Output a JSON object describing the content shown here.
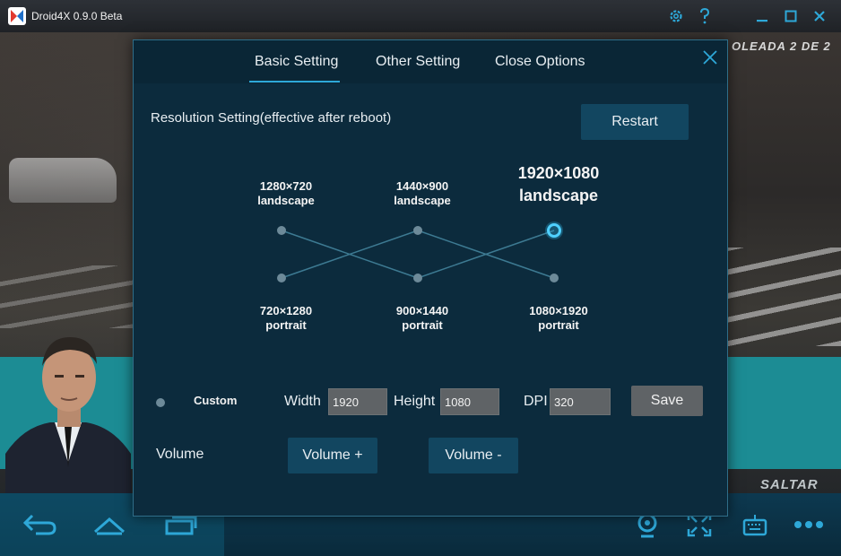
{
  "window": {
    "title": "Droid4X 0.9.0 Beta"
  },
  "game": {
    "wave_text": "OLEADA 2 DE 2",
    "skip_text": "SALTAR"
  },
  "tabs": [
    {
      "label": "Basic Setting",
      "active": true
    },
    {
      "label": "Other Setting",
      "active": false
    },
    {
      "label": "Close Options",
      "active": false
    }
  ],
  "resolution": {
    "title": "Resolution Setting(effective after reboot)",
    "restart_label": "Restart",
    "options_top": [
      {
        "size": "1280×720",
        "orientation": "landscape"
      },
      {
        "size": "1440×900",
        "orientation": "landscape"
      },
      {
        "size": "1920×1080",
        "orientation": "landscape",
        "selected": true
      }
    ],
    "options_bottom": [
      {
        "size": "720×1280",
        "orientation": "portrait"
      },
      {
        "size": "900×1440",
        "orientation": "portrait"
      },
      {
        "size": "1080×1920",
        "orientation": "portrait"
      }
    ]
  },
  "custom": {
    "label": "Custom",
    "width_label": "Width",
    "width_value": "1920",
    "height_label": "Height",
    "height_value": "1080",
    "dpi_label": "DPI",
    "dpi_value": "320",
    "save_label": "Save"
  },
  "volume": {
    "label": "Volume",
    "up_label": "Volume +",
    "down_label": "Volume -"
  },
  "colors": {
    "accent": "#2ea8d8",
    "dialog_bg": "#0c2b3d",
    "button_bg": "#124660"
  }
}
